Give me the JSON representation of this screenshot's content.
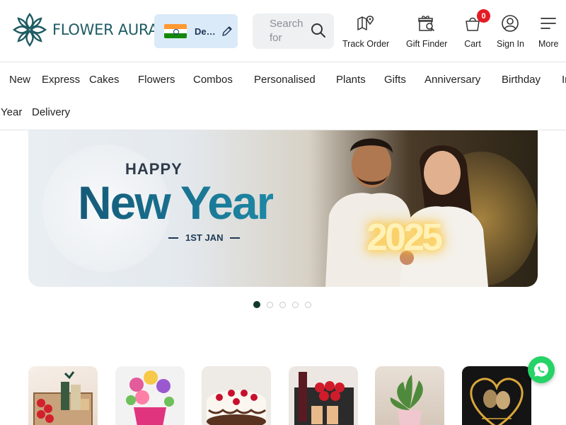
{
  "header": {
    "logo_text": "FLOWER AURA",
    "country_code": "De…",
    "search_placeholder": "Search for",
    "nav": [
      {
        "label": "Track Order",
        "icon": "map-pin-icon"
      },
      {
        "label": "Gift Finder",
        "icon": "gift-search-icon"
      },
      {
        "label": "Cart",
        "icon": "cart-icon",
        "badge": "0"
      },
      {
        "label": "Sign In",
        "icon": "user-icon"
      },
      {
        "label": "More",
        "icon": "menu-icon"
      }
    ]
  },
  "categories": [
    "New Year",
    "Express Delivery",
    "Cakes",
    "Flowers",
    "Combos",
    "Personalised",
    "Plants",
    "Gifts",
    "Anniversary",
    "Birthday",
    "In"
  ],
  "banner": {
    "kicker": "HAPPY",
    "title": "New Year",
    "date": "1ST JAN",
    "year": "2025"
  },
  "carousel": {
    "count": 5,
    "active": 0
  },
  "products": [
    {
      "name": "Gift hamper with roses"
    },
    {
      "name": "Mixed flower bouquet"
    },
    {
      "name": "Black forest cake"
    },
    {
      "name": "Wine and roses combo"
    },
    {
      "name": "Potted plant"
    },
    {
      "name": "Personalised photo frame"
    }
  ],
  "colors": {
    "brand": "#1f5c63",
    "accent": "#e31b23",
    "whatsapp": "#25d366"
  }
}
